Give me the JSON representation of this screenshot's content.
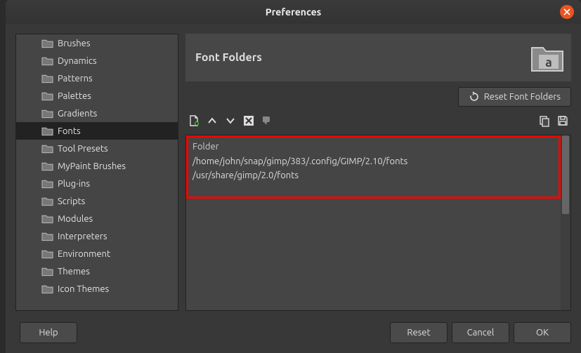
{
  "window": {
    "title": "Preferences"
  },
  "sidebar": {
    "items": [
      {
        "label": "Brushes"
      },
      {
        "label": "Dynamics"
      },
      {
        "label": "Patterns"
      },
      {
        "label": "Palettes"
      },
      {
        "label": "Gradients"
      },
      {
        "label": "Fonts"
      },
      {
        "label": "Tool Presets"
      },
      {
        "label": "MyPaint Brushes"
      },
      {
        "label": "Plug-ins"
      },
      {
        "label": "Scripts"
      },
      {
        "label": "Modules"
      },
      {
        "label": "Interpreters"
      },
      {
        "label": "Environment"
      },
      {
        "label": "Themes"
      },
      {
        "label": "Icon Themes"
      }
    ],
    "selected_index": 5
  },
  "panel": {
    "title": "Font Folders",
    "reset_label": "Reset Font Folders",
    "list_header": "Folder",
    "folders": [
      "/home/john/snap/gimp/383/.config/GIMP/2.10/fonts",
      "/usr/share/gimp/2.0/fonts"
    ]
  },
  "footer": {
    "help": "Help",
    "reset": "Reset",
    "cancel": "Cancel",
    "ok": "OK"
  }
}
